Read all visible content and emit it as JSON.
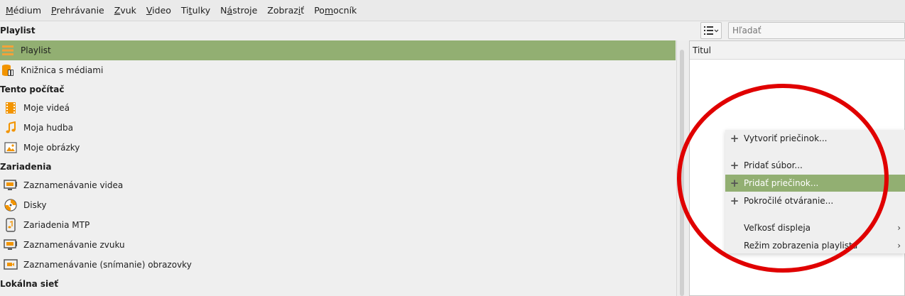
{
  "menubar": {
    "items": [
      {
        "pre": "",
        "u": "M",
        "post": "édium"
      },
      {
        "pre": "",
        "u": "P",
        "post": "rehrávanie"
      },
      {
        "pre": "",
        "u": "Z",
        "post": "vuk"
      },
      {
        "pre": "",
        "u": "V",
        "post": "ideo"
      },
      {
        "pre": "Ti",
        "u": "t",
        "post": "ulky"
      },
      {
        "pre": "N",
        "u": "á",
        "post": "stroje"
      },
      {
        "pre": "Zobraz",
        "u": "i",
        "post": "ť"
      },
      {
        "pre": "Po",
        "u": "m",
        "post": "ocník"
      }
    ]
  },
  "sidebar": {
    "title": "Playlist",
    "top_items": [
      {
        "label": "Playlist",
        "icon": "playlist-icon",
        "selected": true
      },
      {
        "label": "Knižnica s médiami",
        "icon": "media-library-icon",
        "selected": false
      }
    ],
    "sections": [
      {
        "title": "Tento počítač",
        "items": [
          {
            "label": "Moje videá",
            "icon": "film-icon"
          },
          {
            "label": "Moja hudba",
            "icon": "music-note-icon"
          },
          {
            "label": "Moje obrázky",
            "icon": "picture-icon"
          }
        ]
      },
      {
        "title": "Zariadenia",
        "items": [
          {
            "label": "Zaznamenávanie videa",
            "icon": "capture-device-icon"
          },
          {
            "label": "Disky",
            "icon": "disc-icon"
          },
          {
            "label": "Zariadenia MTP",
            "icon": "mtp-device-icon"
          },
          {
            "label": "Zaznamenávanie zvuku",
            "icon": "capture-device-icon"
          },
          {
            "label": "Zaznamenávanie (snímanie) obrazovky",
            "icon": "screen-capture-icon"
          }
        ]
      },
      {
        "title": "Lokálna sieť",
        "items": []
      }
    ]
  },
  "search": {
    "placeholder": "Hľadať"
  },
  "playlist": {
    "column_title": "Titul"
  },
  "context_menu": {
    "items": [
      {
        "label": "Vytvoriť priečinok...",
        "icon": "plus-icon"
      },
      {
        "label": "Pridať súbor...",
        "icon": "plus-icon"
      },
      {
        "label": "Pridať priečinok...",
        "icon": "plus-icon",
        "highlighted": true
      },
      {
        "label": "Pokročilé otváranie...",
        "icon": "plus-icon"
      },
      {
        "label": "Veľkosť displeja",
        "submenu": true
      },
      {
        "label": "Režim zobrazenia playlistu",
        "submenu": true
      }
    ]
  },
  "colors": {
    "selection": "#92af72",
    "annotation": "#e00000",
    "icon_orange": "#f29400"
  }
}
